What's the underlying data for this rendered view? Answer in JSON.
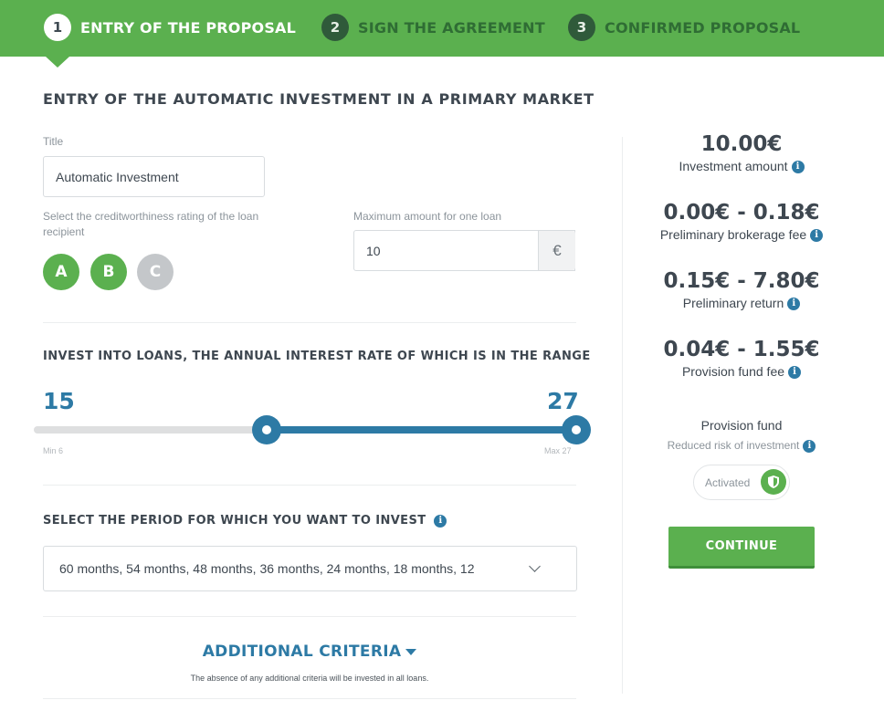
{
  "steps": [
    {
      "number": "1",
      "label": "ENTRY OF THE PROPOSAL"
    },
    {
      "number": "2",
      "label": "SIGN THE AGREEMENT"
    },
    {
      "number": "3",
      "label": "CONFIRMED PROPOSAL"
    }
  ],
  "active_step": 1,
  "form": {
    "heading": "ENTRY OF THE AUTOMATIC INVESTMENT IN A PRIMARY MARKET",
    "title_label": "Title",
    "title_value": "Automatic Investment",
    "rating_label": "Select the creditworthiness rating of the loan recipient",
    "ratings": [
      {
        "letter": "A",
        "selected": true
      },
      {
        "letter": "B",
        "selected": true
      },
      {
        "letter": "C",
        "selected": false
      }
    ],
    "max_amount_label": "Maximum amount for one loan",
    "max_amount_value": "10",
    "currency_symbol": "€",
    "rate_heading": "INVEST INTO LOANS, THE ANNUAL INTEREST RATE OF WHICH IS IN THE RANGE",
    "rate_min_selected": "15",
    "rate_max_selected": "27",
    "rate_min_label": "Min 6",
    "rate_max_label": "Max 27",
    "rate_range": {
      "min": 6,
      "max": 27,
      "from": 15,
      "to": 27
    },
    "period_heading": "SELECT THE PERIOD FOR WHICH YOU WANT TO INVEST",
    "period_value": "60 months, 54 months, 48 months, 36 months, 24 months, 18 months, 12",
    "additional_criteria": "ADDITIONAL CRITERIA",
    "additional_note": "The absence of any additional criteria will be invested in all loans."
  },
  "summary": {
    "investment_amount": "10.00€",
    "investment_amount_label": "Investment amount",
    "brokerage_fee": "0.00€ - 0.18€",
    "brokerage_fee_label": "Preliminary brokerage fee",
    "return": "0.15€ - 7.80€",
    "return_label": "Preliminary return",
    "provision_fee": "0.04€ - 1.55€",
    "provision_fee_label": "Provision fund fee",
    "provision_title": "Provision fund",
    "provision_sub": "Reduced risk of investment",
    "provision_status": "Activated",
    "continue_label": "CONTINUE"
  },
  "colors": {
    "brand_green": "#5bb04f",
    "accent_blue": "#2d7aa5",
    "text_dark": "#3e4750"
  },
  "icons": [
    "info-icon",
    "chevron-down-icon",
    "caret-down-icon",
    "shield-icon"
  ]
}
